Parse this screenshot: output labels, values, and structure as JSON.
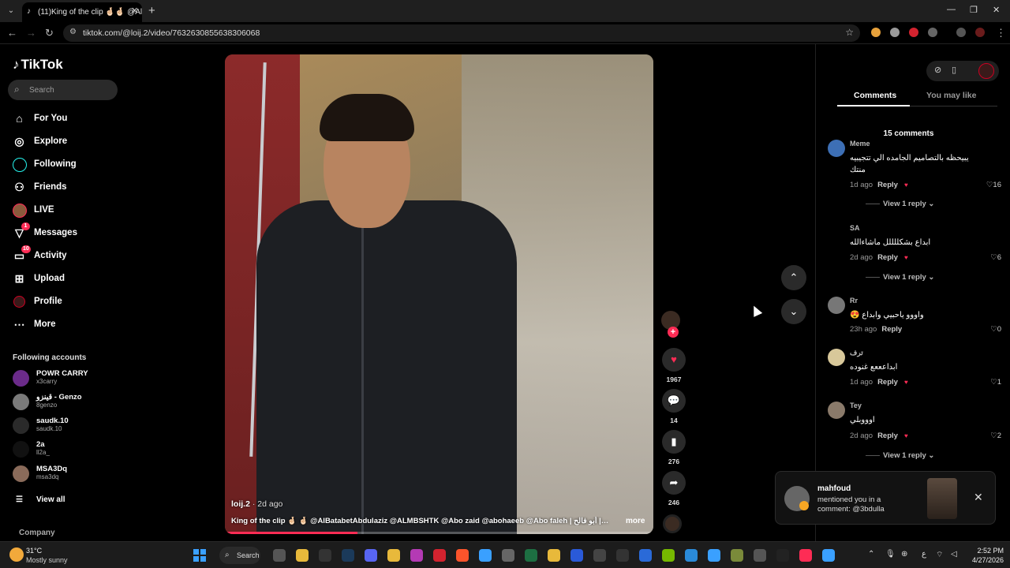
{
  "browser": {
    "tab_title": "(11)King of the clip 🤞🏻🤞🏻 @Al…",
    "url": "tiktok.com/@loij.2/video/7632630855638306068"
  },
  "sidebar": {
    "logo": "TikTok",
    "search_placeholder": "Search",
    "nav": [
      {
        "label": "For You",
        "icon": "home-icon"
      },
      {
        "label": "Explore",
        "icon": "compass-icon"
      },
      {
        "label": "Following",
        "icon": "following-ring-icon"
      },
      {
        "label": "Friends",
        "icon": "friends-icon"
      },
      {
        "label": "LIVE",
        "icon": "live-icon"
      },
      {
        "label": "Messages",
        "icon": "messages-icon",
        "badge": "1"
      },
      {
        "label": "Activity",
        "icon": "activity-icon",
        "badge": "10"
      },
      {
        "label": "Upload",
        "icon": "upload-icon"
      },
      {
        "label": "Profile",
        "icon": "profile-avatar-icon"
      },
      {
        "label": "More",
        "icon": "more-icon"
      }
    ],
    "following_title": "Following accounts",
    "accounts": [
      {
        "name": "POWR CARRY",
        "handle": "x3carry",
        "color": "#6b2b8a"
      },
      {
        "name": "قينزو - Genzo",
        "handle": "8genzo",
        "color": "#7a7a7a"
      },
      {
        "name": "saudk.10",
        "handle": "saudk.10",
        "color": "#2a2a2a"
      },
      {
        "name": "2a",
        "handle": "ll2a_",
        "color": "#111111"
      },
      {
        "name": "MSA3Dq",
        "handle": "msa3dq",
        "color": "#8a6b5a"
      }
    ],
    "view_all": "View all",
    "company": "Company"
  },
  "video": {
    "author": "loij.2",
    "date": " · 2d ago",
    "caption": "King of the clip 🤞🏻 🤞🏻 @AlBatabetAbdulaziz @ALMBSHTK @Abo zaid @abohaeeb @Abo faleh | أبو فالح | 🤞🏻 ...",
    "more": "more",
    "progress": 0.31,
    "likes": "1967",
    "comments": "14",
    "saves": "276",
    "shares": "246"
  },
  "panel": {
    "tab_comments": "Comments",
    "tab_you_may_like": "You may like",
    "count_label": "15 comments",
    "comments": [
      {
        "user": "Meme",
        "text": "يبيحظه بالتصاميم الجامده الي تتجيبيه منتك",
        "time": "1d ago",
        "reply": "Reply",
        "likes": "16",
        "view_reply": "View 1 reply",
        "avatar": "#3d6fb5"
      },
      {
        "user": "SA",
        "text": "ابداع بشكللللل ماشاءالله",
        "time": "2d ago",
        "reply": "Reply",
        "likes": "6",
        "view_reply": "View 1 reply",
        "avatar": "#000000"
      },
      {
        "user": "Rr",
        "text": "واووو ياحبيي وابداع 😍",
        "time": "23h ago",
        "reply": "Reply",
        "likes": "0",
        "view_reply": "",
        "avatar": "#777777"
      },
      {
        "user": "ترف",
        "text": "ابداعععع غنوده",
        "time": "1d ago",
        "reply": "Reply",
        "likes": "1",
        "view_reply": "",
        "avatar": "#d8c89a"
      },
      {
        "user": "Tey",
        "text": "اوووبلي",
        "time": "2d ago",
        "reply": "Reply",
        "likes": "2",
        "view_reply": "View 1 reply",
        "avatar": "#8a7a6a"
      }
    ],
    "notification": {
      "name": "mahfoud",
      "text": "mentioned you in a comment: @3bdulla"
    }
  },
  "taskbar": {
    "temp": "31°C",
    "weather": "Mostly sunny",
    "search": "Search",
    "time": "2:52 PM",
    "date": "4/27/2026",
    "lang": "ع"
  }
}
